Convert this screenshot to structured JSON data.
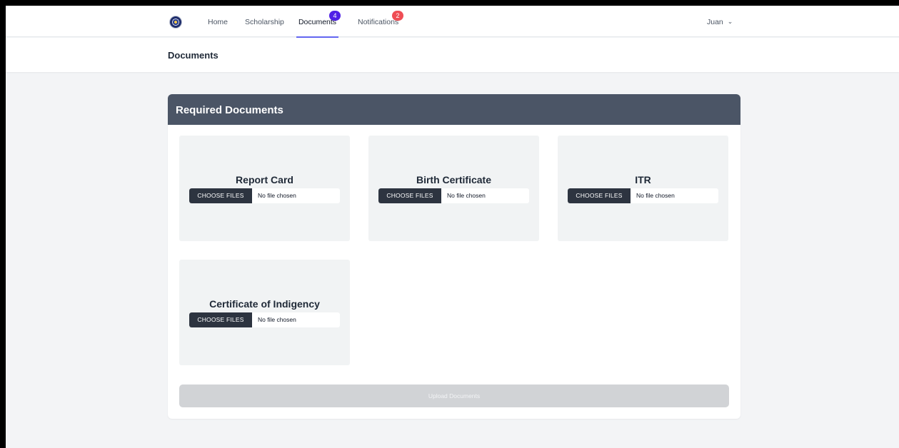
{
  "nav": {
    "home": "Home",
    "scholarship": "Scholarship",
    "documents": "Documents",
    "documents_badge": "4",
    "notifications": "Notifications",
    "notifications_badge": "2",
    "user": "Juan",
    "user_chevron": "⌄"
  },
  "page": {
    "title": "Documents"
  },
  "card": {
    "title": "Required Documents",
    "documents": [
      {
        "title": "Report Card",
        "button": "CHOOSE FILES",
        "status": "No file chosen"
      },
      {
        "title": "Birth Certificate",
        "button": "CHOOSE FILES",
        "status": "No file chosen"
      },
      {
        "title": "ITR",
        "button": "CHOOSE FILES",
        "status": "No file chosen"
      },
      {
        "title": "Certificate of Indigency",
        "button": "CHOOSE FILES",
        "status": "No file chosen"
      }
    ],
    "upload_label": "Upload Documents"
  },
  "colors": {
    "card_header": "#4b5566",
    "documents_badge": "#4f20e6",
    "notifications_badge": "#ef4e55",
    "active_tab_underline": "#6366f1"
  },
  "icons": {
    "logo": "seal-logo-icon",
    "user_menu": "chevron-down-icon"
  }
}
